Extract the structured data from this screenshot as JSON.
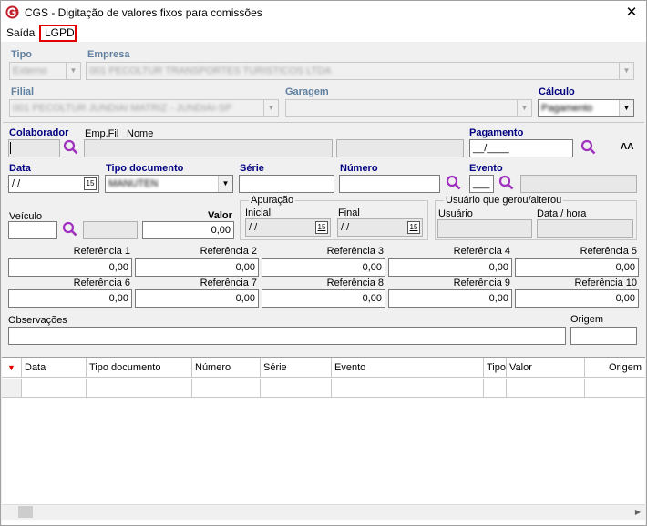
{
  "window": {
    "title": "CGS - Digitação de valores fixos para comissões",
    "close": "✕"
  },
  "menu": {
    "saida": "Saída",
    "lgpd": "LGPD"
  },
  "labels": {
    "tipo": "Tipo",
    "empresa": "Empresa",
    "filial": "Filial",
    "garagem": "Garagem",
    "calculo": "Cálculo",
    "colaborador": "Colaborador",
    "empfil": "Emp.Fil",
    "nome": "Nome",
    "pagamento": "Pagamento",
    "data": "Data",
    "tipo_documento": "Tipo documento",
    "serie": "Série",
    "numero": "Número",
    "evento": "Evento",
    "veiculo": "Veículo",
    "valor": "Valor",
    "apuracao": "Apuração",
    "inicial": "Inicial",
    "final": "Final",
    "usuario_group": "Usuário que gerou/alterou",
    "usuario": "Usuário",
    "data_hora": "Data / hora",
    "observacoes": "Observações",
    "origem": "Origem"
  },
  "values": {
    "tipo": "Externo",
    "empresa": "001 PECOLTUR TRANSPORTES TURISTICOS LTDA",
    "filial": "001 PECOLTUR JUNDIAI MATRIZ - JUNDIAI-SP",
    "garagem": "",
    "calculo": "Pagamento",
    "colaborador": "",
    "pagamento": "__/____",
    "data": " / /",
    "tipo_documento": "MANUTEN",
    "valor": "0,00",
    "inicial": " / /",
    "final": " / /",
    "evento": "___"
  },
  "refs": [
    {
      "label": "Referência 1",
      "value": "0,00"
    },
    {
      "label": "Referência 2",
      "value": "0,00"
    },
    {
      "label": "Referência 3",
      "value": "0,00"
    },
    {
      "label": "Referência 4",
      "value": "0,00"
    },
    {
      "label": "Referência 5",
      "value": "0,00"
    },
    {
      "label": "Referência 6",
      "value": "0,00"
    },
    {
      "label": "Referência 7",
      "value": "0,00"
    },
    {
      "label": "Referência 8",
      "value": "0,00"
    },
    {
      "label": "Referência 9",
      "value": "0,00"
    },
    {
      "label": "Referência 10",
      "value": "0,00"
    }
  ],
  "grid": {
    "columns": [
      "Data",
      "Tipo documento",
      "Número",
      "Série",
      "Evento",
      "Tipo",
      "Valor",
      "Origem"
    ]
  },
  "aa_icon": "AA",
  "cal_icon": "15",
  "colors": {
    "accent_bold": "#000080",
    "search": "#a030c0",
    "highlight": "#e00000"
  }
}
